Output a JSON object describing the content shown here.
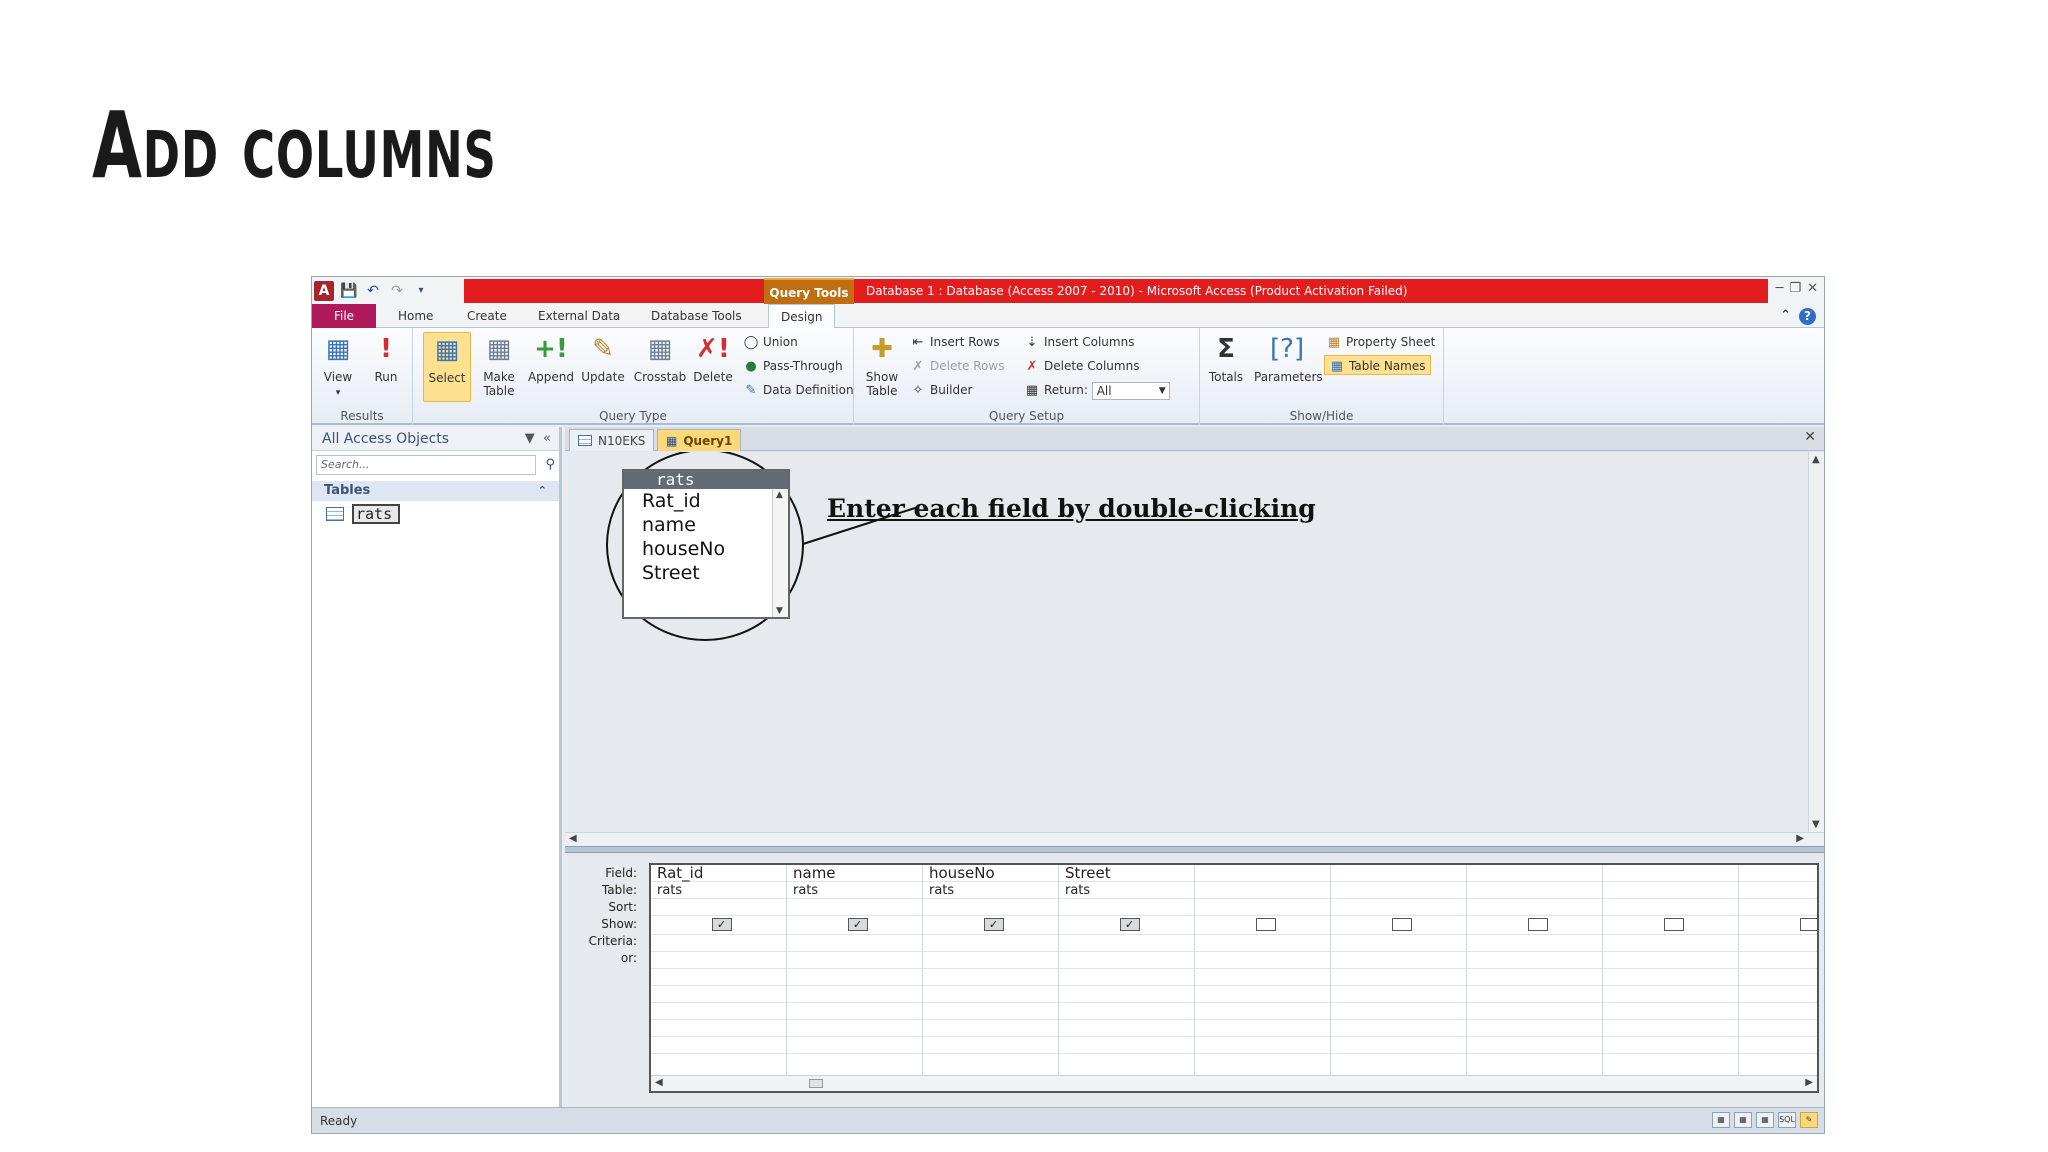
{
  "slide": {
    "title": "Add columns"
  },
  "window": {
    "context_tab": "Query Tools",
    "title": "Database 1 : Database (Access 2007 - 2010)  -  Microsoft Access (Product Activation Failed)"
  },
  "ribbon_tabs": {
    "file": "File",
    "home": "Home",
    "create": "Create",
    "external": "External Data",
    "dbtools": "Database Tools",
    "design": "Design"
  },
  "results": {
    "label": "Results",
    "view": "View",
    "run": "Run"
  },
  "query_type": {
    "label": "Query Type",
    "select": "Select",
    "make_table_1": "Make",
    "make_table_2": "Table",
    "append": "Append",
    "update": "Update",
    "crosstab": "Crosstab",
    "delete": "Delete",
    "union": "Union",
    "pass_through": "Pass-Through",
    "data_definition": "Data Definition"
  },
  "query_setup": {
    "label": "Query Setup",
    "show_table_1": "Show",
    "show_table_2": "Table",
    "insert_rows": "Insert Rows",
    "delete_rows": "Delete Rows",
    "builder": "Builder",
    "insert_columns": "Insert Columns",
    "delete_columns": "Delete Columns",
    "return_label": "Return:",
    "return_value": "All"
  },
  "show_hide": {
    "label": "Show/Hide",
    "totals": "Totals",
    "parameters": "Parameters",
    "property_sheet": "Property Sheet",
    "table_names": "Table Names"
  },
  "nav": {
    "header": "All Access Objects",
    "search_placeholder": "Search...",
    "group": "Tables",
    "items": [
      {
        "label": "rats"
      }
    ]
  },
  "doc_tabs": [
    {
      "label": "N10EKS"
    },
    {
      "label": "Query1"
    }
  ],
  "field_list": {
    "title": "rats",
    "fields": [
      "Rat_id",
      "name",
      "houseNo",
      "Street"
    ]
  },
  "annotation": "Enter each field by double-clicking",
  "grid": {
    "row_labels": [
      "Field:",
      "Table:",
      "Sort:",
      "Show:",
      "Criteria:",
      "or:"
    ],
    "columns": [
      {
        "field": "Rat_id",
        "table": "rats",
        "show": true
      },
      {
        "field": "name",
        "table": "rats",
        "show": true
      },
      {
        "field": "houseNo",
        "table": "rats",
        "show": true
      },
      {
        "field": "Street",
        "table": "rats",
        "show": true
      },
      {
        "field": "",
        "table": "",
        "show": false
      },
      {
        "field": "",
        "table": "",
        "show": false
      },
      {
        "field": "",
        "table": "",
        "show": false
      },
      {
        "field": "",
        "table": "",
        "show": false
      },
      {
        "field": "",
        "table": "",
        "show": false
      }
    ]
  },
  "status": {
    "text": "Ready",
    "sql": "SQL"
  },
  "colors": {
    "title_red": "#e31d1d",
    "file_tab": "#b0195a",
    "active_yellow": "#fde190"
  }
}
